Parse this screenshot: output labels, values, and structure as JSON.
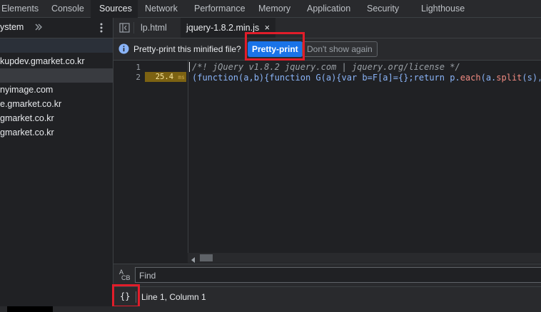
{
  "devtools_tabs": [
    "Elements",
    "Console",
    "Sources",
    "Network",
    "Performance",
    "Memory",
    "Application",
    "Security",
    "Lighthouse"
  ],
  "active_tab": "Sources",
  "sidebar": {
    "header_label": "ystem",
    "items": [
      {
        "label": "kupdev.gmarket.co.kr"
      },
      {
        "label": ""
      },
      {
        "label": "nyimage.com"
      },
      {
        "label": "e.gmarket.co.kr"
      },
      {
        "label": "gmarket.co.kr"
      },
      {
        "label": "gmarket.co.kr"
      }
    ]
  },
  "editor_tabs": [
    {
      "label": "lp.html"
    },
    {
      "label": "jquery-1.8.2.min.js",
      "close": "×"
    }
  ],
  "infobar": {
    "message": "Pretty-print this minified file?",
    "pretty_print": "Pretty-print",
    "dont_show": "Don't show again"
  },
  "gutter": {
    "lines": [
      "1",
      "2"
    ],
    "timing_value": "25.4",
    "timing_unit": "ms"
  },
  "code": {
    "line1": "/*! jQuery v1.8.2 jquery.com | jquery.org/license */",
    "line2_parts": [
      "(function(a,b){function G(a){var b=F[a]={};return p.",
      "each",
      "(a.",
      "split",
      "(s),functio"
    ]
  },
  "find": {
    "icon_top": "A",
    "icon_bottom": "CB",
    "placeholder": "Find"
  },
  "status": {
    "pretty_icon": "{}",
    "position": "Line 1, Column 1"
  },
  "colors": {
    "background": "#202124",
    "panel": "#292a2d",
    "accent_button": "#1a73e8",
    "highlight_red": "#e11d2a",
    "comment": "#9aa0a6"
  }
}
